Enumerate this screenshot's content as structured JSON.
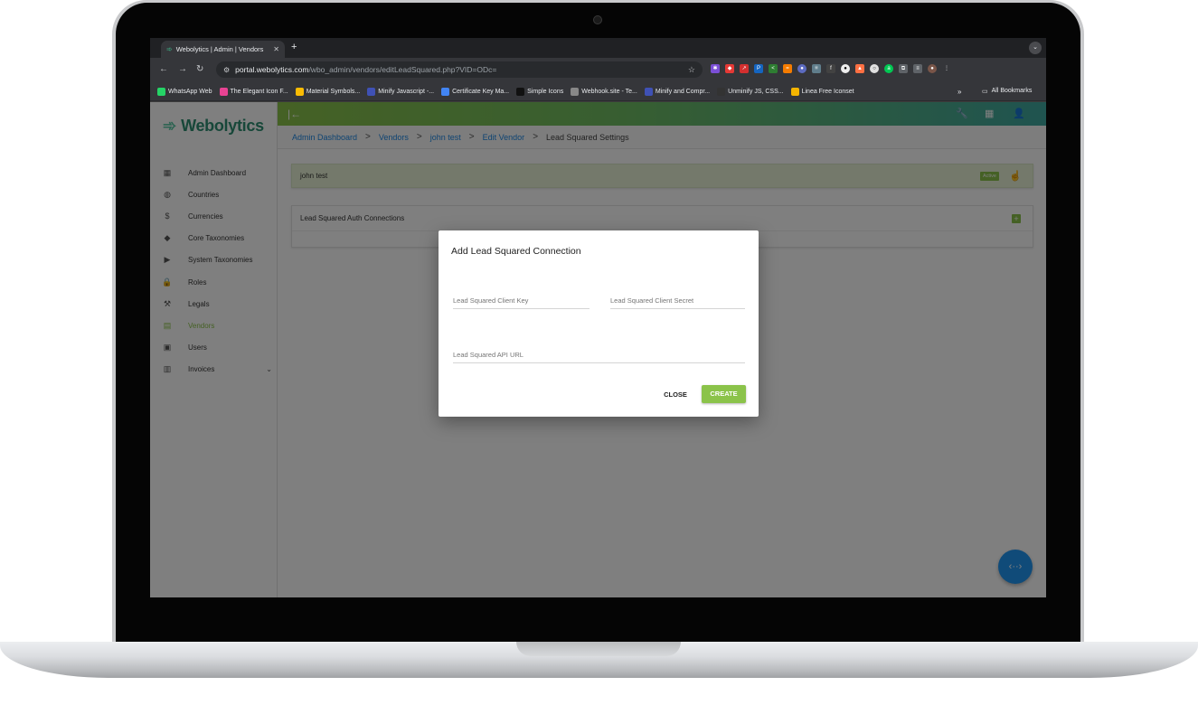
{
  "browser": {
    "tab_title": "Webolytics | Admin | Vendors",
    "new_tab": "+",
    "url_host": "portal.webolytics.com",
    "url_path": "/wbo_admin/vendors/editLeadSquared.php?VID=ODc=",
    "bookmarks": [
      {
        "label": "WhatsApp Web",
        "icon": "whatsapp-icon",
        "color": "#25d366"
      },
      {
        "label": "The Elegant Icon F...",
        "icon": "elegant-icon",
        "color": "#e84393"
      },
      {
        "label": "Material Symbols...",
        "icon": "material-icon",
        "color": "#fbbc04"
      },
      {
        "label": "Minify Javascript -...",
        "icon": "minify-icon",
        "color": "#3f51b5"
      },
      {
        "label": "Certificate Key Ma...",
        "icon": "certificate-icon",
        "color": "#4285f4"
      },
      {
        "label": "Simple Icons",
        "icon": "simpleicons-icon",
        "color": "#111111"
      },
      {
        "label": "Webhook.site - Te...",
        "icon": "webhook-icon",
        "color": "#888888"
      },
      {
        "label": "Minify and Compr...",
        "icon": "minify2-icon",
        "color": "#3f51b5"
      },
      {
        "label": "Unminify JS, CSS...",
        "icon": "unminify-icon",
        "color": "#333333"
      },
      {
        "label": "Linea Free Iconset",
        "icon": "linea-icon",
        "color": "#f4b400"
      }
    ],
    "bookmarks_more": "»",
    "all_bookmarks": "All Bookmarks"
  },
  "app": {
    "brand": "Webolytics",
    "sidebar": [
      {
        "label": "Admin Dashboard",
        "icon": "dashboard-icon",
        "glyph": "▦"
      },
      {
        "label": "Countries",
        "icon": "globe-icon",
        "glyph": "◍"
      },
      {
        "label": "Currencies",
        "icon": "currency-icon",
        "glyph": "$"
      },
      {
        "label": "Core Taxonomies",
        "icon": "tag-icon",
        "glyph": "◆"
      },
      {
        "label": "System Taxonomies",
        "icon": "label-icon",
        "glyph": "▶"
      },
      {
        "label": "Roles",
        "icon": "lock-icon",
        "glyph": "🔒"
      },
      {
        "label": "Legals",
        "icon": "gavel-icon",
        "glyph": "⚒"
      },
      {
        "label": "Vendors",
        "icon": "business-icon",
        "glyph": "▤",
        "active": true
      },
      {
        "label": "Users",
        "icon": "users-icon",
        "glyph": "▣"
      },
      {
        "label": "Invoices",
        "icon": "invoice-icon",
        "glyph": "▥",
        "chevron": "⌄"
      }
    ],
    "breadcrumb": [
      "Admin Dashboard",
      "Vendors",
      "john test",
      "Edit Vendor",
      "Lead Squared Settings"
    ],
    "breadcrumb_sep": ">",
    "vendor_name": "john test",
    "status_badge": "Active",
    "section_title": "Lead Squared Auth Connections",
    "add_button": "+"
  },
  "dialog": {
    "title": "Add Lead Squared Connection",
    "client_key_placeholder": "Lead Squared Client Key",
    "client_secret_placeholder": "Lead Squared Client Secret",
    "api_url_placeholder": "Lead Squared API URL",
    "close_label": "CLOSE",
    "create_label": "CREATE"
  },
  "colors": {
    "accent_green": "#8bc34a",
    "brand_teal": "#2f8f72",
    "link_blue": "#1e88e5",
    "fab_blue": "#2196f3"
  }
}
